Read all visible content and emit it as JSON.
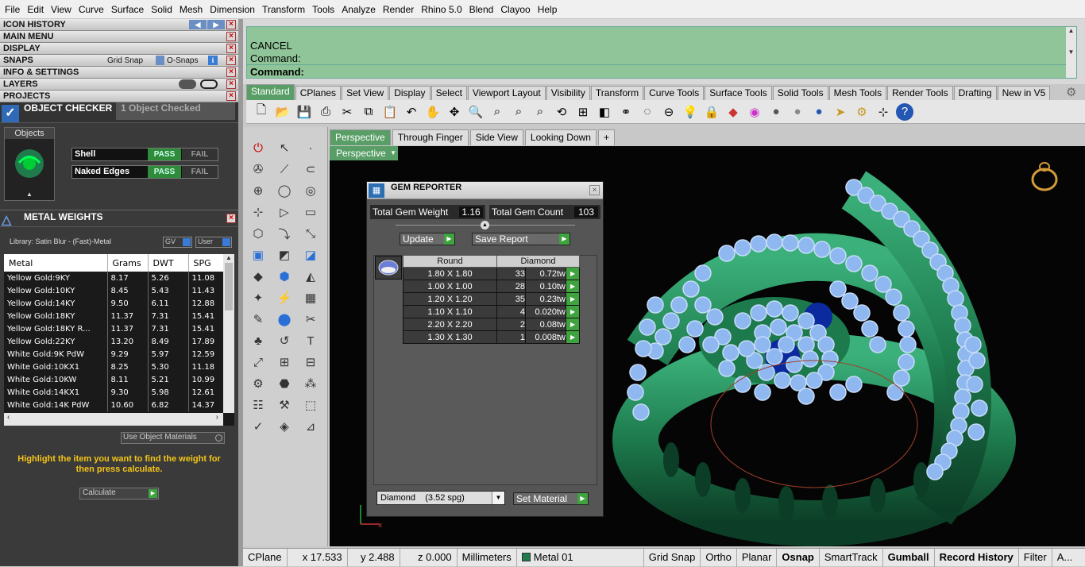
{
  "menu": [
    "File",
    "Edit",
    "View",
    "Curve",
    "Surface",
    "Solid",
    "Mesh",
    "Dimension",
    "Transform",
    "Tools",
    "Analyze",
    "Render",
    "Rhino 5.0",
    "Blend",
    "Clayoo",
    "Help"
  ],
  "panels": {
    "icon_history": "ICON HISTORY",
    "main_menu": "MAIN MENU",
    "display": "DISPLAY",
    "snaps": "SNAPS",
    "grid_snap": "Grid Snap",
    "osnaps": "O-Snaps",
    "info": "INFO & SETTINGS",
    "layers": "LAYERS",
    "projects": "PROJECTS"
  },
  "object_checker": {
    "title": "OBJECT CHECKER",
    "status": "1 Object Checked",
    "objects_label": "Objects",
    "rows": [
      {
        "label": "Shell",
        "pass": "PASS",
        "fail": "FAIL"
      },
      {
        "label": "Naked Edges",
        "pass": "PASS",
        "fail": "FAIL"
      }
    ]
  },
  "metal_weights": {
    "title": "METAL WEIGHTS",
    "library": "Library: Satin Blur - (Fast)-Metal",
    "gv": "GV",
    "user": "User",
    "columns": [
      "Metal",
      "Grams",
      "DWT",
      "SPG"
    ],
    "rows": [
      [
        "Yellow Gold:9KY",
        "8.17",
        "5.26",
        "11.08"
      ],
      [
        "Yellow Gold:10KY",
        "8.45",
        "5.43",
        "11.43"
      ],
      [
        "Yellow Gold:14KY",
        "9.50",
        "6.11",
        "12.88"
      ],
      [
        "Yellow Gold:18KY",
        "11.37",
        "7.31",
        "15.41"
      ],
      [
        "Yellow Gold:18KY R...",
        "11.37",
        "7.31",
        "15.41"
      ],
      [
        "Yellow Gold:22KY",
        "13.20",
        "8.49",
        "17.89"
      ],
      [
        "White Gold:9K PdW",
        "9.29",
        "5.97",
        "12.59"
      ],
      [
        "White Gold:10KX1",
        "8.25",
        "5.30",
        "11.18"
      ],
      [
        "White Gold:10KW",
        "8.11",
        "5.21",
        "10.99"
      ],
      [
        "White Gold:14KX1",
        "9.30",
        "5.98",
        "12.61"
      ],
      [
        "White Gold:14K PdW",
        "10.60",
        "6.82",
        "14.37"
      ]
    ],
    "use_object_materials": "Use Object Materials",
    "hint": "Highlight the item you want to find the weight for then press calculate.",
    "calculate": "Calculate"
  },
  "command": {
    "line1": "CANCEL",
    "line2": "Command:",
    "prompt": "Command:"
  },
  "toolbar_tabs": [
    "Standard",
    "CPlanes",
    "Set View",
    "Display",
    "Select",
    "Viewport Layout",
    "Visibility",
    "Transform",
    "Curve Tools",
    "Surface Tools",
    "Solid Tools",
    "Mesh Tools",
    "Render Tools",
    "Drafting",
    "New in V5"
  ],
  "viewport_tabs": [
    "Perspective",
    "Through Finger",
    "Side View",
    "Looking Down",
    "+"
  ],
  "viewport_label": "Perspective",
  "gem_reporter": {
    "title": "GEM REPORTER",
    "total_weight_label": "Total Gem Weight",
    "total_weight": "1.16",
    "total_count_label": "Total Gem Count",
    "total_count": "103",
    "update": "Update",
    "save_report": "Save Report",
    "col_shape": "Round",
    "col_type": "Diamond",
    "rows": [
      [
        "1.80 X 1.80",
        "33",
        "0.72tw"
      ],
      [
        "1.00 X 1.00",
        "28",
        "0.10tw"
      ],
      [
        "1.20 X 1.20",
        "35",
        "0.23tw"
      ],
      [
        "1.10 X 1.10",
        "4",
        "0.020tw"
      ],
      [
        "2.20 X 2.20",
        "2",
        "0.08tw"
      ],
      [
        "1.30 X 1.30",
        "1",
        "0.008tw"
      ]
    ],
    "material": "Diamond    (3.52 spg)",
    "set_material": "Set Material"
  },
  "status": {
    "cplane": "CPlane",
    "x": "x 17.533",
    "y": "y 2.488",
    "z": "z 0.000",
    "units": "Millimeters",
    "layer": "Metal 01",
    "items": [
      "Grid Snap",
      "Ortho",
      "Planar",
      "Osnap",
      "SmartTrack",
      "Gumball",
      "Record History",
      "Filter",
      "A..."
    ]
  },
  "colors": {
    "accent": "#5a9e67",
    "pass": "#2e8b3a",
    "ring": "#1f7a4c",
    "gem": "#8fb8f0"
  }
}
